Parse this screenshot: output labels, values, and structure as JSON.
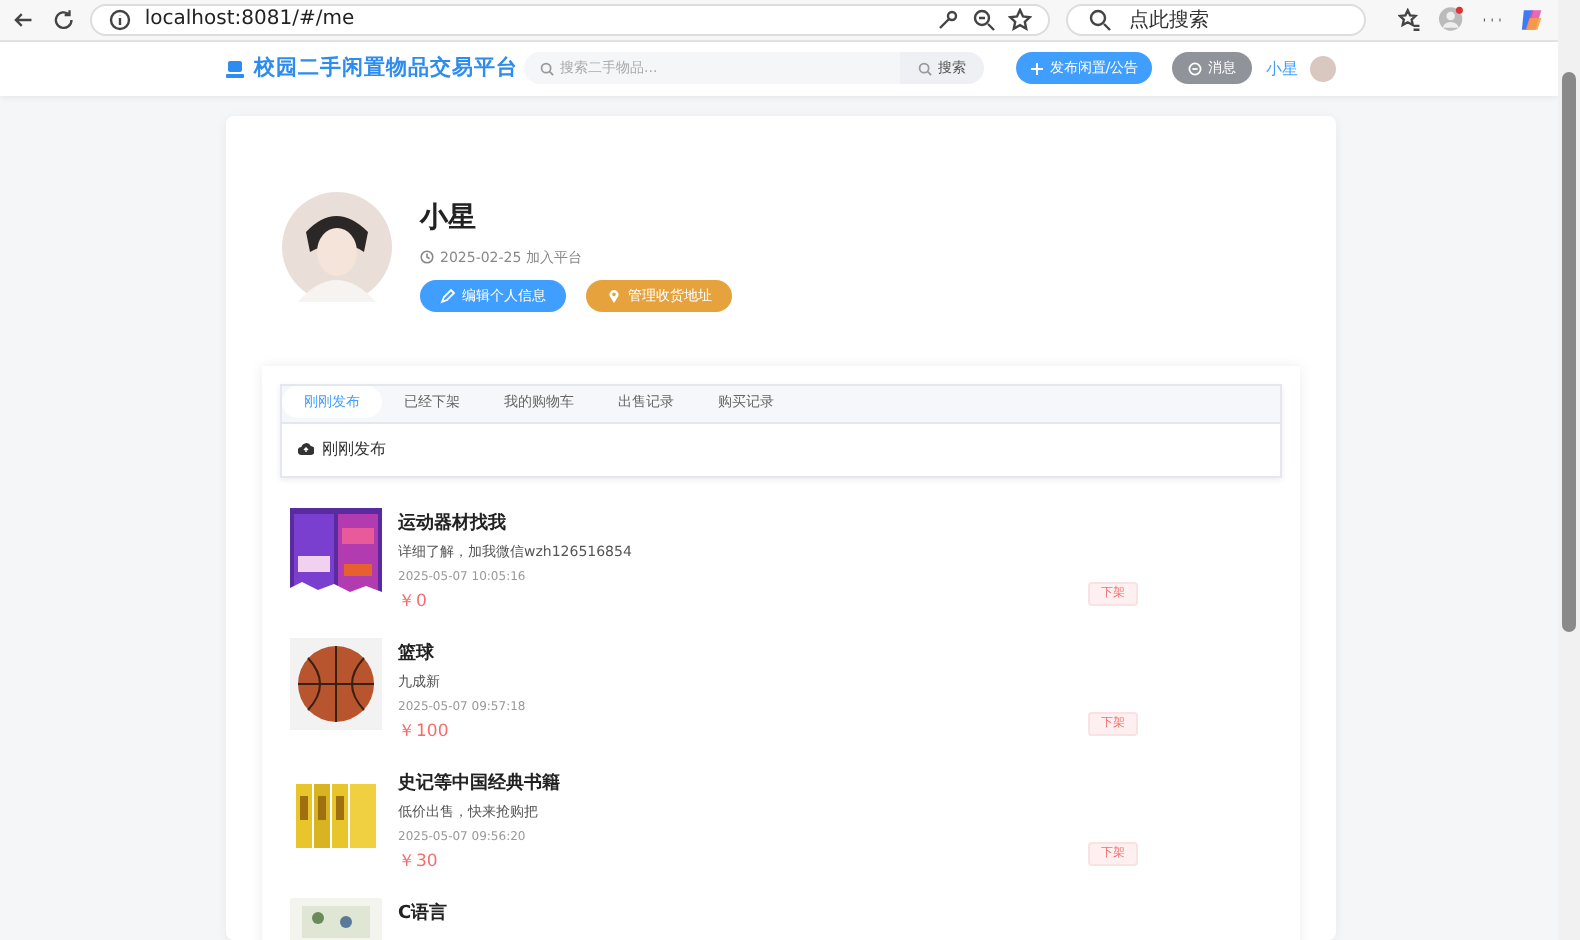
{
  "browser": {
    "url": "localhost:8081/#/me",
    "search_placeholder": "点此搜索"
  },
  "header": {
    "logo": "校园二手闲置物品交易平台",
    "search_placeholder": "搜索二手物品...",
    "search_button": "搜索",
    "publish_button": "发布闲置/公告",
    "message_button": "消息",
    "username": "小星"
  },
  "profile": {
    "name": "小星",
    "joined": "2025-02-25 加入平台",
    "buttons": [
      {
        "label": "编辑个人信息",
        "kind": "edit"
      },
      {
        "label": "管理收货地址",
        "kind": "address"
      }
    ]
  },
  "tabs": [
    {
      "label": "刚刚发布",
      "selected": true
    },
    {
      "label": "已经下架",
      "selected": false
    },
    {
      "label": "我的购物车",
      "selected": false
    },
    {
      "label": "出售记录",
      "selected": false
    },
    {
      "label": "购买记录",
      "selected": false
    }
  ],
  "section_title": "刚刚发布",
  "items": [
    {
      "title": "运动器材找我",
      "description": "详细了解，加我微信wzh126516854",
      "time": "2025-05-07 10:05:16",
      "price": "￥0",
      "action": "下架"
    },
    {
      "title": "篮球",
      "description": "九成新",
      "time": "2025-05-07 09:57:18",
      "price": "￥100",
      "action": "下架"
    },
    {
      "title": "史记等中国经典书籍",
      "description": "低价出售，快来抢购把",
      "time": "2025-05-07 09:56:20",
      "price": "￥30",
      "action": "下架"
    },
    {
      "title": "C语言"
    }
  ]
}
